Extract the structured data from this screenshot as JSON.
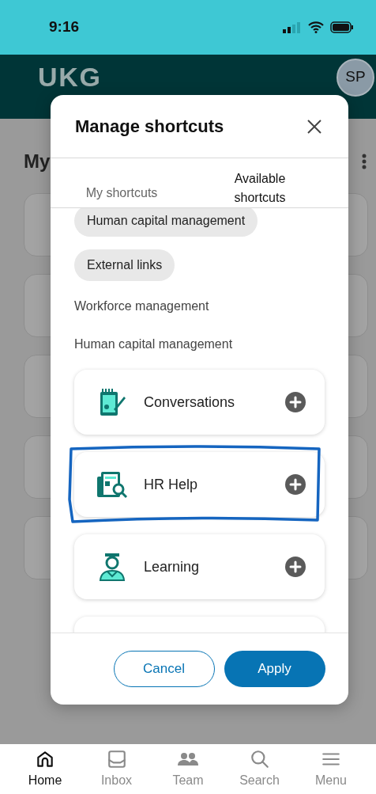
{
  "status_bar": {
    "time": "9:16"
  },
  "header": {
    "logo": "UKG",
    "avatar": "SP"
  },
  "page": {
    "title_fragment": "My"
  },
  "dialog": {
    "title": "Manage shortcuts",
    "tabs": [
      {
        "label": "My shortcuts",
        "selected": false
      },
      {
        "label": "Available shortcuts",
        "selected": true
      }
    ],
    "items": [
      {
        "kind": "chip",
        "label": "Human capital management"
      },
      {
        "kind": "chip",
        "label": "External links"
      },
      {
        "kind": "heading",
        "label": "Workforce management"
      },
      {
        "kind": "heading",
        "label": "Human capital management"
      },
      {
        "kind": "shortcut",
        "label": "Conversations",
        "highlighted": false
      },
      {
        "kind": "shortcut",
        "label": "HR Help",
        "highlighted": true
      },
      {
        "kind": "shortcut",
        "label": "Learning",
        "highlighted": false
      },
      {
        "kind": "shortcut-partial"
      }
    ],
    "buttons": [
      {
        "label": "Cancel",
        "kind": "secondary"
      },
      {
        "label": "Apply",
        "kind": "primary"
      }
    ]
  },
  "nav": [
    {
      "label": "Home",
      "selected": true
    },
    {
      "label": "Inbox",
      "selected": false
    },
    {
      "label": "Team",
      "selected": false
    },
    {
      "label": "Search",
      "selected": false
    },
    {
      "label": "Menu",
      "selected": false
    }
  ]
}
